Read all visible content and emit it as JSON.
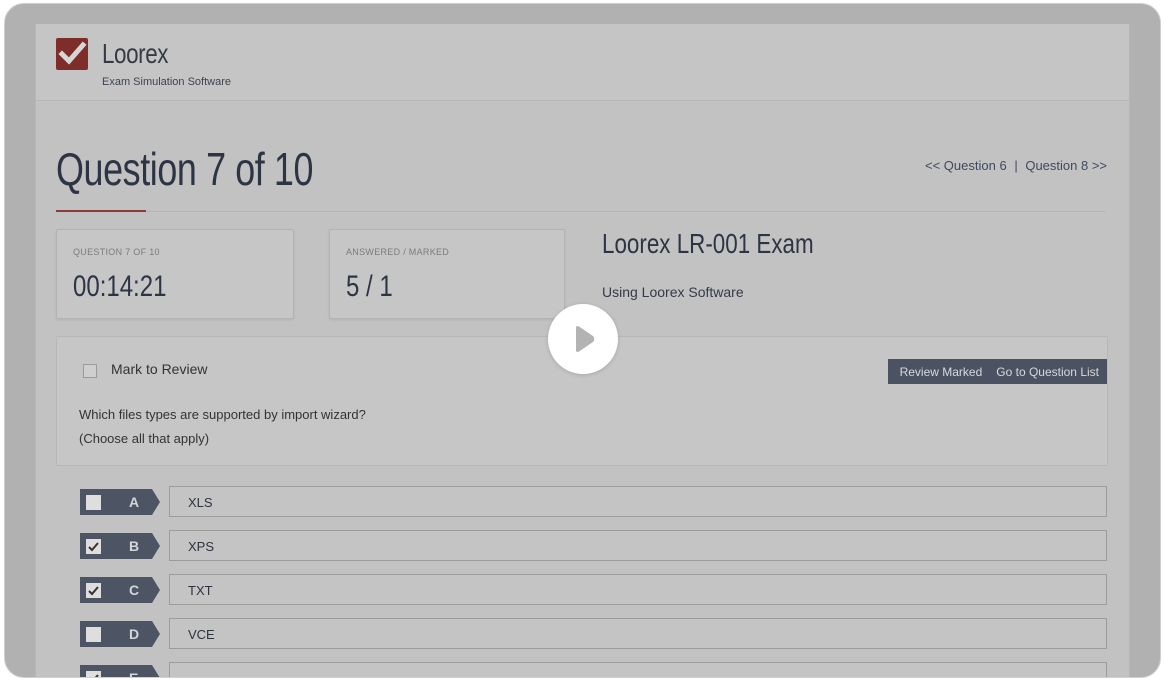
{
  "app": {
    "name": "Loorex",
    "subtitle": "Exam Simulation Software"
  },
  "question": {
    "title": "Question 7 of 10",
    "nav_prev": "<< Question 6",
    "nav_sep": "|",
    "nav_next": "Question 8 >>"
  },
  "stats": {
    "timer_label": "QUESTION 7 OF 10",
    "timer_value": "00:14:21",
    "answered_label": "ANSWERED / MARKED",
    "answered_value": "5 / 1"
  },
  "exam": {
    "title": "Loorex LR-001 Exam",
    "subtitle": "Using Loorex Software"
  },
  "panel": {
    "mark_label": "Mark to Review",
    "mark_checked": false,
    "question_line1": "Which files types are supported by import wizard?",
    "question_line2": "(Choose all that apply)",
    "review_marked_button": "Review Marked",
    "question_list_button": "Go to Question List"
  },
  "answers": [
    {
      "letter": "A",
      "text": "XLS",
      "checked": false
    },
    {
      "letter": "B",
      "text": "XPS",
      "checked": true
    },
    {
      "letter": "C",
      "text": "TXT",
      "checked": true
    },
    {
      "letter": "D",
      "text": "VCE",
      "checked": false
    },
    {
      "letter": "E",
      "text": "",
      "checked": true
    }
  ],
  "overlay": {
    "icon": "play-icon"
  },
  "colors": {
    "brand_red": "#c0392b",
    "tab_dark": "#4d5464",
    "overlay_dim": "#b1b1b1"
  }
}
